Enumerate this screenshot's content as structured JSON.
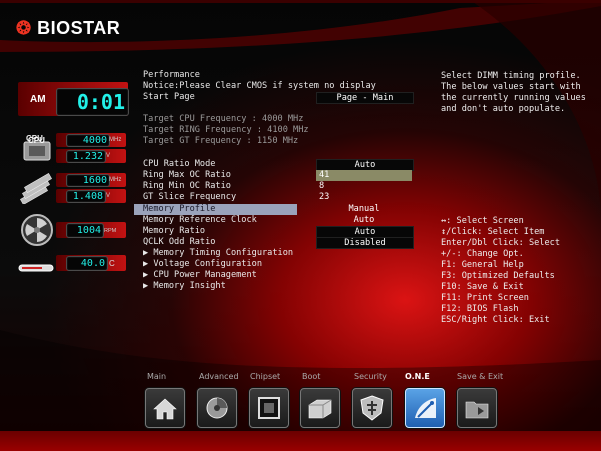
{
  "brand": "BIOSTAR",
  "clock": {
    "ampm": "AM",
    "time": "0:01"
  },
  "monitors": {
    "cpu_label": "CPU",
    "cpu_freq": "4000",
    "cpu_freq_unit": "MHz",
    "cpu_volt": "1.232",
    "cpu_volt_unit": "V",
    "mem_freq": "1600",
    "mem_freq_unit": "MHz",
    "mem_volt": "1.408",
    "mem_volt_unit": "V",
    "fan_rpm": "1004",
    "fan_unit": "RPM",
    "temp": "40.0",
    "temp_unit": "C"
  },
  "main": {
    "rows": [
      {
        "label": "Performance",
        "value": "",
        "style": "plain"
      },
      {
        "label": "Notice:Please Clear CMOS if system no display",
        "value": "",
        "style": "plain"
      },
      {
        "label": "Start Page",
        "value": "Page - Main",
        "style": "box"
      },
      {
        "label": "",
        "value": "",
        "style": "blank"
      },
      {
        "label": "Target CPU Frequency : 4000 MHz",
        "value": "",
        "style": "grey"
      },
      {
        "label": "Target RING Frequency : 4100 MHz",
        "value": "",
        "style": "grey"
      },
      {
        "label": "Target GT Frequency : 1150 MHz",
        "value": "",
        "style": "grey"
      },
      {
        "label": "",
        "value": "",
        "style": "blank"
      },
      {
        "label": "CPU Ratio Mode",
        "value": "Auto",
        "style": "box"
      },
      {
        "label": "Ring Max OC Ratio",
        "value": "41",
        "style": "hl"
      },
      {
        "label": "Ring Min OC Ratio",
        "value": "8",
        "style": "left"
      },
      {
        "label": "GT Slice Frequency",
        "value": "23",
        "style": "left"
      },
      {
        "label": "Memory Profile",
        "value": "Manual",
        "style": "sel"
      },
      {
        "label": "Memory Reference Clock",
        "value": "Auto",
        "style": "plainval"
      },
      {
        "label": "Memory Ratio",
        "value": "Auto",
        "style": "box"
      },
      {
        "label": "QCLK Odd Ratio",
        "value": "Disabled",
        "style": "box"
      },
      {
        "label": "▶ Memory Timing Configuration",
        "value": "",
        "style": "plain"
      },
      {
        "label": "▶ Voltage Configuration",
        "value": "",
        "style": "plain"
      },
      {
        "label": "▶ CPU Power Management",
        "value": "",
        "style": "plain"
      },
      {
        "label": "▶ Memory Insight",
        "value": "",
        "style": "plain"
      }
    ]
  },
  "help": {
    "lines": [
      "Select DIMM timing profile.",
      "The below values start with",
      "the currently running values",
      "and don't auto populate."
    ]
  },
  "keys": {
    "lines": [
      "↔: Select Screen",
      "↕/Click: Select Item",
      "Enter/Dbl Click: Select",
      "+/-: Change Opt.",
      "F1: General Help",
      "F3: Optimized Defaults",
      "F10: Save & Exit",
      "F11: Print Screen",
      "F12: BIOS Flash",
      "ESC/Right Click: Exit"
    ]
  },
  "tabs": [
    {
      "label": "Main",
      "icon": "home-icon"
    },
    {
      "label": "Advanced",
      "icon": "advanced-icon"
    },
    {
      "label": "Chipset",
      "icon": "chipset-icon"
    },
    {
      "label": "Boot",
      "icon": "boot-drive-icon"
    },
    {
      "label": "Security",
      "icon": "security-shield-icon"
    },
    {
      "label": "O.N.E",
      "icon": "one-overclock-icon",
      "active": true
    },
    {
      "label": "Save & Exit",
      "icon": "save-exit-icon"
    }
  ],
  "colors": {
    "accent": "#e32222",
    "led": "#22f0e8",
    "selected": "#9aa3bb",
    "highlight": "#8a8a66"
  }
}
